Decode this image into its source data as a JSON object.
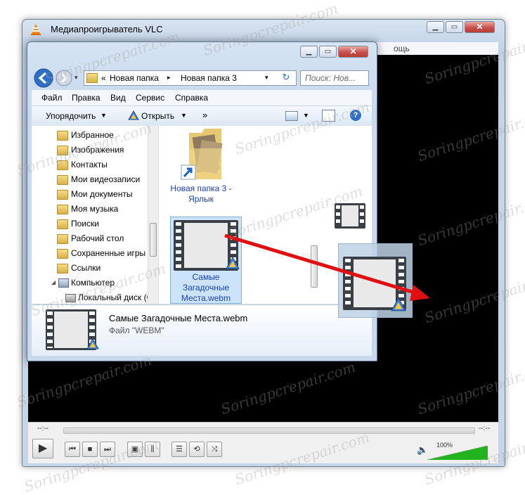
{
  "vlc": {
    "title": "Медиапроигрыватель VLC",
    "menu_fragment": "ощь",
    "time_elapsed": "--:--",
    "time_total": "--:--",
    "volume_label": "100%",
    "volume_level": 1.0,
    "accent_color": "#22b31f"
  },
  "explorer": {
    "breadcrumb_prefix": "«",
    "breadcrumb": [
      "Новая папка",
      "Новая папка 3"
    ],
    "search_placeholder": "Поиск: Нов...",
    "menu": [
      "Файл",
      "Правка",
      "Вид",
      "Сервис",
      "Справка"
    ],
    "toolbar": {
      "organize": "Упорядочить",
      "open": "Открыть",
      "more": "»"
    },
    "nav_items": [
      "Избранное",
      "Изображения",
      "Контакты",
      "Мои видеозаписи",
      "Мои документы",
      "Моя музыка",
      "Поиски",
      "Рабочий стол",
      "Сохраненные игры",
      "Ссылки",
      "Компьютер",
      "Локальный диск (C:"
    ],
    "items": [
      {
        "name": "Новая папка 3 - Ярлык",
        "line1": "Новая папка 3 -",
        "line2": "Ярлык"
      },
      {
        "name": "Самые Загадочные Места.webm",
        "line1": "Самые",
        "line2": "Загадочные",
        "line3": "Места.webm"
      }
    ],
    "details": {
      "file_name": "Самые Загадочные Места.webm",
      "file_type": "Файл \"WEBM\""
    }
  },
  "watermark": "Soringpcrepair.com",
  "colors": {
    "arrow": "#e01010",
    "selection": "#cce4fb",
    "link_text": "#1a3fbf"
  }
}
